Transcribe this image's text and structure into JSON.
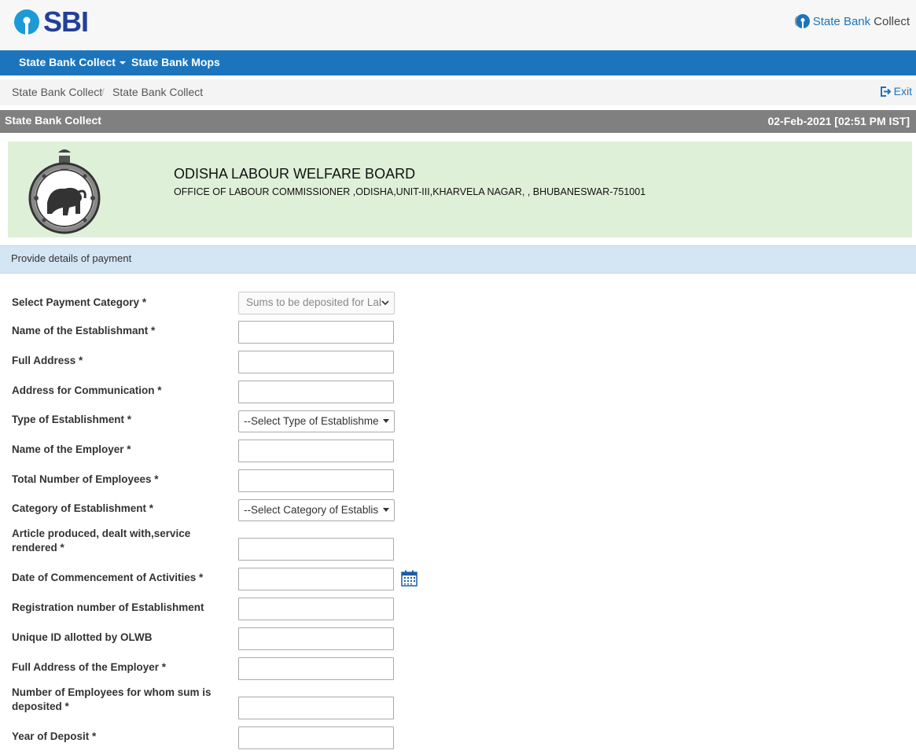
{
  "header": {
    "logo_text": "SBI",
    "brand_part1": "State Bank",
    "brand_part2": "Collect",
    "brand_color": "#1c75bc",
    "logo_color": "#22409a"
  },
  "nav": {
    "items": [
      {
        "label": "State Bank Collect",
        "has_dropdown": true
      },
      {
        "label": "State Bank Mops",
        "has_dropdown": false
      }
    ],
    "background": "#1c75bc"
  },
  "breadcrumb": {
    "items": [
      "State Bank Collect",
      "State Bank Collect"
    ],
    "separator": "/",
    "exit_label": "Exit"
  },
  "titlebar": {
    "title": "State Bank Collect",
    "datetime": "02-Feb-2021 [02:51 PM IST]"
  },
  "organization": {
    "name": "ODISHA LABOUR WELFARE BOARD",
    "address": "OFFICE OF LABOUR COMMISSIONER ,ODISHA,UNIT-III,KHARVELA NAGAR, , BHUBANESWAR-751001",
    "emblem_icon": "odisha-emblem-icon"
  },
  "section": {
    "heading": "Provide details of payment"
  },
  "form": {
    "fields": [
      {
        "label": "Select Payment Category *",
        "type": "select",
        "value": "Sums to be deposited for Labour Welfare Fund",
        "disabled": true
      },
      {
        "label": "Name of the Establishmant *",
        "type": "text",
        "value": ""
      },
      {
        "label": "Full Address *",
        "type": "text",
        "value": ""
      },
      {
        "label": "Address for Communication *",
        "type": "text",
        "value": ""
      },
      {
        "label": "Type of Establishment *",
        "type": "select",
        "value": "--Select Type of Establishment--"
      },
      {
        "label": "Name of the Employer *",
        "type": "text",
        "value": ""
      },
      {
        "label": "Total Number of Employees *",
        "type": "text",
        "value": ""
      },
      {
        "label": "Category of Establishment *",
        "type": "select",
        "value": "--Select Category of Establishment--"
      },
      {
        "label": "Article produced, dealt with,service rendered *",
        "type": "text",
        "value": ""
      },
      {
        "label": "Date of Commencement of Activities *",
        "type": "date",
        "value": ""
      },
      {
        "label": "Registration number of Establishment",
        "type": "text",
        "value": ""
      },
      {
        "label": "Unique ID allotted by OLWB",
        "type": "text",
        "value": ""
      },
      {
        "label": "Full Address of the Employer *",
        "type": "text",
        "value": ""
      },
      {
        "label": "Number of Employees for whom sum is deposited *",
        "type": "text",
        "value": ""
      },
      {
        "label": "Year of Deposit *",
        "type": "text",
        "value": ""
      }
    ]
  }
}
